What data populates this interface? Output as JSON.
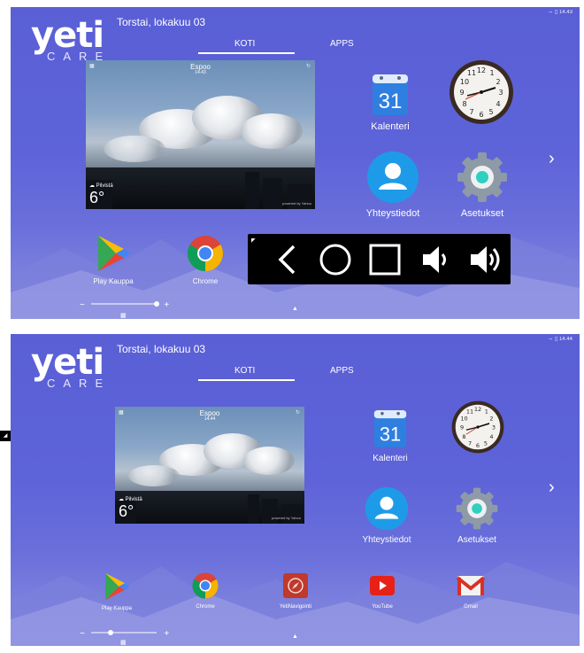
{
  "screens": [
    {
      "status": {
        "icons": "⇔ ▯",
        "time": "14.43"
      },
      "logo": {
        "main": "yeti",
        "sub": "CARE"
      },
      "date": "Torstai, lokakuu 03",
      "tabs": {
        "home": "KOTI",
        "apps": "APPS"
      },
      "weather": {
        "city": "Espoo",
        "time": "14.43",
        "condition": "Pilvistä",
        "temp": "6°",
        "credit": "powered by Yahoo"
      },
      "apps": {
        "calendar_day": "31",
        "calendar": "Kalenteri",
        "contacts": "Yhteystiedot",
        "settings": "Asetukset",
        "playstore": "Play Kauppa",
        "chrome": "Chrome"
      },
      "slider": {
        "minus": "−",
        "plus": "+"
      }
    },
    {
      "status": {
        "icons": "⇔ ▯",
        "time": "14.44"
      },
      "logo": {
        "main": "yeti",
        "sub": "CARE"
      },
      "date": "Torstai, lokakuu 03",
      "tabs": {
        "home": "KOTI",
        "apps": "APPS"
      },
      "weather": {
        "city": "Espoo",
        "time": "14.44",
        "condition": "Pilvistä",
        "temp": "6°",
        "credit": "powered by Yahoo"
      },
      "apps": {
        "calendar_day": "31",
        "calendar": "Kalenteri",
        "contacts": "Yhteystiedot",
        "settings": "Asetukset",
        "playstore": "Play Kauppa",
        "chrome": "Chrome",
        "navigation": "YetiNavigointi",
        "youtube": "YouTube",
        "gmail": "Gmail"
      },
      "slider": {
        "minus": "−",
        "plus": "+"
      }
    }
  ],
  "icons": {
    "next": "chevron-right-icon",
    "up": "arrow-up-icon",
    "grid": "app-grid-icon",
    "nav_back": "back-icon",
    "nav_home": "home-icon",
    "nav_recents": "recents-icon",
    "vol_down": "volume-down-icon",
    "vol_up": "volume-up-icon"
  },
  "colors": {
    "background": "#5d63d8",
    "calendar_blue": "#2f7fe0",
    "contacts_blue": "#1e9be8",
    "settings_gray": "#8e9aa6",
    "youtube_red": "#e62117",
    "nav_red": "#c0392b"
  }
}
